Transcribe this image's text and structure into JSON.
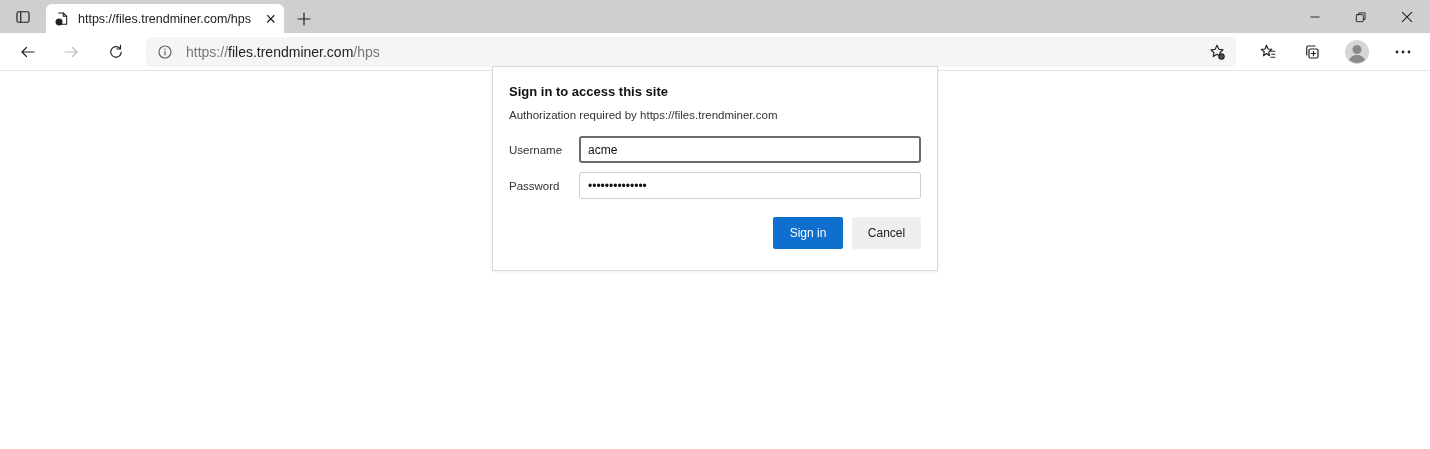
{
  "tabs": [
    {
      "title": "https://files.trendminer.com/hps",
      "selected": true,
      "close": "×"
    }
  ],
  "address": {
    "scheme": "https://",
    "host": "files.trendminer.com",
    "path": "/hps"
  },
  "dialog": {
    "title": "Sign in to access this site",
    "message": "Authorization required by https://files.trendminer.com",
    "fields": [
      {
        "label": "Username",
        "value": "acme",
        "focused": true
      },
      {
        "label": "Password",
        "value": "••••••••••••••",
        "focused": false
      }
    ],
    "buttons": [
      {
        "label": "Sign in",
        "primary": true
      },
      {
        "label": "Cancel",
        "primary": false
      }
    ]
  }
}
